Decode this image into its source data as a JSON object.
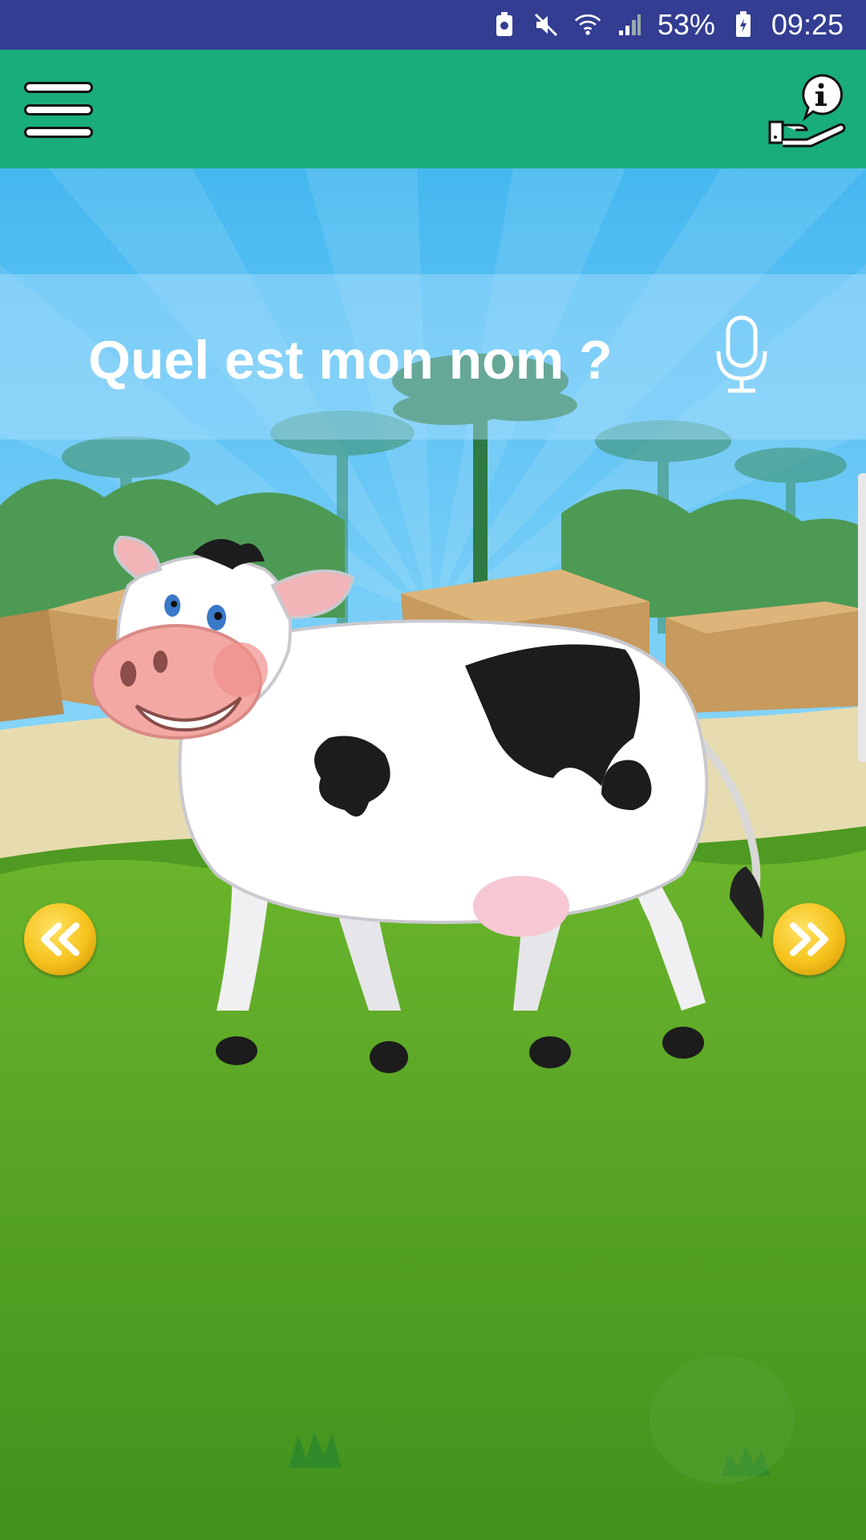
{
  "status_bar": {
    "battery_percent": "53%",
    "time": "09:25",
    "icons": [
      "battery-saver-icon",
      "mute-icon",
      "wifi-icon",
      "signal-icon",
      "battery-icon"
    ]
  },
  "app_bar": {
    "menu_icon": "hamburger-menu-icon",
    "info_icon": "info-hand-icon"
  },
  "question": {
    "text": "Quel est mon nom ?",
    "mic_icon": "microphone-icon"
  },
  "navigation": {
    "prev_icon": "double-chevron-left-icon",
    "next_icon": "double-chevron-right-icon"
  },
  "colors": {
    "status_bar": "#333d91",
    "app_bar": "#19ad7b",
    "sky": "#4fbbf0",
    "grass": "#4f9a22",
    "nav_gold": "#f5c21b"
  }
}
